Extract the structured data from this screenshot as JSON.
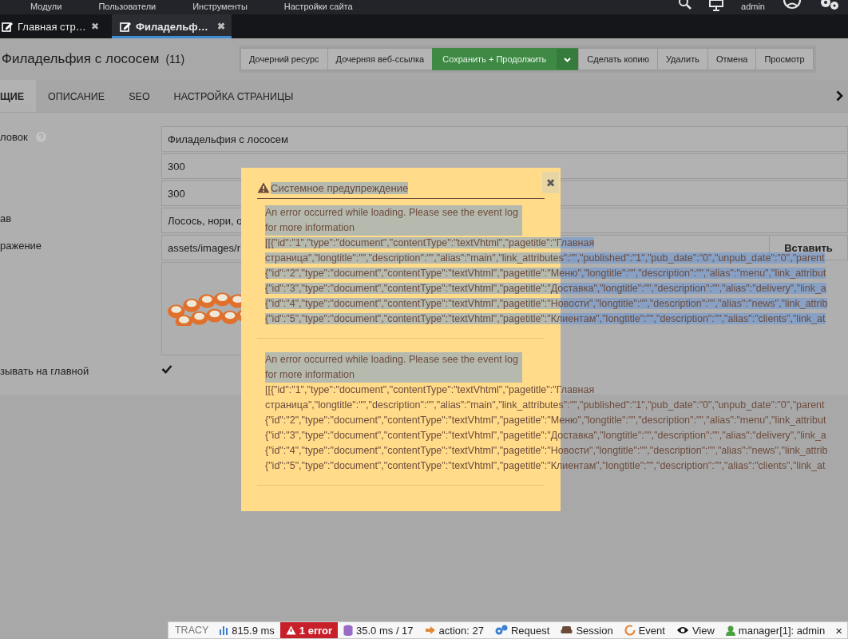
{
  "top_menu": [
    "Модули",
    "Пользователи",
    "Инструменты",
    "Настройки сайта"
  ],
  "user": "admin",
  "doc_tabs": [
    {
      "label": "Главная стр…",
      "selected": false,
      "close": "✖"
    },
    {
      "label": "Филадельф…",
      "selected": true,
      "close": "✖"
    }
  ],
  "resource": {
    "title": "Филадельфия с лососем",
    "id": "(11)"
  },
  "actions": [
    {
      "label": "Дочерний ресурс",
      "kind": "plain"
    },
    {
      "label": "Дочерняя веб-ссылка",
      "kind": "plain"
    },
    {
      "label": "Сохранить + Продолжить",
      "kind": "primary"
    },
    {
      "label": "Сделать копию",
      "kind": "plain"
    },
    {
      "label": "Удалить",
      "kind": "plain"
    },
    {
      "label": "Отмена",
      "kind": "plain"
    },
    {
      "label": "Просмотр",
      "kind": "plain"
    }
  ],
  "section_tabs": [
    {
      "label": "ЩИЕ",
      "selected": true
    },
    {
      "label": "ОПИСАНИЕ",
      "selected": false
    },
    {
      "label": "SEO",
      "selected": false
    },
    {
      "label": "НАСТРОЙКА СТРАНИЦЫ",
      "selected": false
    }
  ],
  "fields": [
    {
      "kind": "text",
      "label": "ловок",
      "help": true,
      "value": "Филадельфия с лососем"
    },
    {
      "kind": "text",
      "value": "300"
    },
    {
      "kind": "text",
      "value": "300"
    },
    {
      "kind": "text",
      "label": "ав",
      "value": "Лосось, нори, о"
    },
    {
      "label": "ражение",
      "value": "assets/images/r",
      "button": "Вставить"
    },
    {
      "kind": "checkbox",
      "label": "зывать на главной",
      "checked": true
    }
  ],
  "dialog": {
    "title": "Системное предупреждение",
    "title_selected": true,
    "close": "✖",
    "messages": [
      {
        "text": "An error occurred while loading. Please see the event log for more information",
        "text_selected": true,
        "data_selected": true,
        "data": [
          "[[{\"id\":\"1\",\"type\":\"document\",\"contentType\":\"textVhtml\",\"pagetitle\":\"Главная",
          "страница\",\"longtitle\":\"\",\"description\":\"\",\"alias\":\"main\",\"link_attributes\":\"\",\"published\":\"1\",\"pub_date\":\"0\",\"unpub_date\":\"0\",\"parent",
          "{\"id\":\"2\",\"type\":\"document\",\"contentType\":\"textVhtml\",\"pagetitle\":\"Меню\",\"longtitle\":\"\",\"description\":\"\",\"alias\":\"menu\",\"link_attribut",
          "{\"id\":\"3\",\"type\":\"document\",\"contentType\":\"textVhtml\",\"pagetitle\":\"Доставка\",\"longtitle\":\"\",\"description\":\"\",\"alias\":\"delivery\",\"link_a",
          "{\"id\":\"4\",\"type\":\"document\",\"contentType\":\"textVhtml\",\"pagetitle\":\"Новости\",\"longtitle\":\"\",\"description\":\"\",\"alias\":\"news\",\"link_attrib",
          "{\"id\":\"5\",\"type\":\"document\",\"contentType\":\"textVhtml\",\"pagetitle\":\"Клиентам\",\"longtitle\":\"\",\"description\":\"\",\"alias\":\"clients\",\"link_at"
        ]
      },
      {
        "text": "An error occurred while loading. Please see the event log for more information",
        "text_selected": true,
        "data_selected": false,
        "data": [
          "[[{\"id\":\"1\",\"type\":\"document\",\"contentType\":\"textVhtml\",\"pagetitle\":\"Главная",
          "страница\",\"longtitle\":\"\",\"description\":\"\",\"alias\":\"main\",\"link_attributes\":\"\",\"published\":\"1\",\"pub_date\":\"0\",\"unpub_date\":\"0\",\"parent",
          "{\"id\":\"2\",\"type\":\"document\",\"contentType\":\"textVhtml\",\"pagetitle\":\"Меню\",\"longtitle\":\"\",\"description\":\"\",\"alias\":\"menu\",\"link_attribut",
          "{\"id\":\"3\",\"type\":\"document\",\"contentType\":\"textVhtml\",\"pagetitle\":\"Доставка\",\"longtitle\":\"\",\"description\":\"\",\"alias\":\"delivery\",\"link_a",
          "{\"id\":\"4\",\"type\":\"document\",\"contentType\":\"textVhtml\",\"pagetitle\":\"Новости\",\"longtitle\":\"\",\"description\":\"\",\"alias\":\"news\",\"link_attrib",
          "{\"id\":\"5\",\"type\":\"document\",\"contentType\":\"textVhtml\",\"pagetitle\":\"Клиентам\",\"longtitle\":\"\",\"description\":\"\",\"alias\":\"clients\",\"link_at"
        ]
      }
    ]
  },
  "debug_bar": [
    {
      "kind": "logo",
      "text": "TRACY"
    },
    {
      "kind": "time",
      "text": "815.9 ms"
    },
    {
      "kind": "error",
      "text": "1 error"
    },
    {
      "kind": "db",
      "text": "35.0 ms / 17"
    },
    {
      "kind": "action",
      "text": "action: 27"
    },
    {
      "kind": "request",
      "text": "Request"
    },
    {
      "kind": "session",
      "text": "Session"
    },
    {
      "kind": "event",
      "text": "Event"
    },
    {
      "kind": "view",
      "text": "View"
    },
    {
      "kind": "user",
      "text": "manager[1]: admin"
    },
    {
      "kind": "close",
      "text": "×"
    }
  ]
}
